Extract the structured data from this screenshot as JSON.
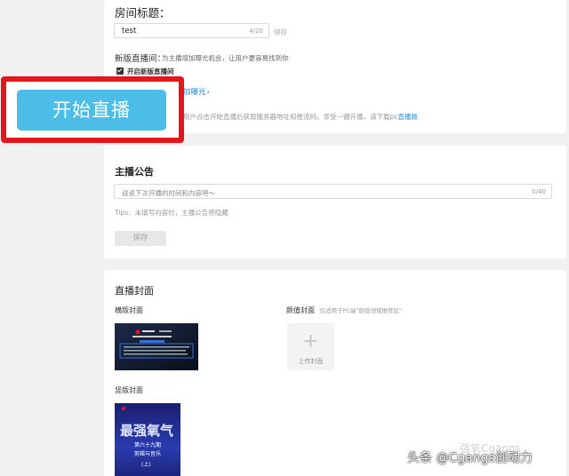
{
  "room": {
    "title_label": "房间标题：",
    "title_value": "test",
    "title_count": "4/20",
    "save_link": "保存",
    "new_live_label": "新版直播间：",
    "new_live_desc": "为主播增加曝光机会，让用户更容易找到你",
    "checkbox_label": "开启新版直播间",
    "exposure_link": "加曝光",
    "help_text_prefix": "用户点击开始直播后获取服务器地址和推流码。享受一键开播，请下载pc",
    "help_link": "直播姬"
  },
  "start_button": {
    "label": "开始直播"
  },
  "announcement": {
    "title": "主播公告",
    "placeholder": "说说下次开播的时间和内容吧～",
    "count": "0/40",
    "tips": "Tips：未填写内容时，主播公告将隐藏",
    "save_label": "保存"
  },
  "cover": {
    "title": "直播封面",
    "horizontal_label": "横版封面",
    "beauty_label": "颜值封面",
    "beauty_note": "仅适用于PC端\"颜值领域推荐区\"",
    "upload_label": "上传封面",
    "vertical_label": "竖版封面",
    "vertical_art_title": "最强氧气",
    "vertical_art_sub1": "第六十九期",
    "vertical_art_sub2": "剪辑与音乐",
    "vertical_art_sub3": "(上)"
  },
  "watermark": {
    "faint_text": "强氧Cgangs",
    "main_text": "头条 @Cgangs创动力"
  },
  "colors": {
    "accent_blue": "#4bbde6",
    "highlight_red": "#e2171b",
    "link_blue": "#2a8ad8"
  }
}
